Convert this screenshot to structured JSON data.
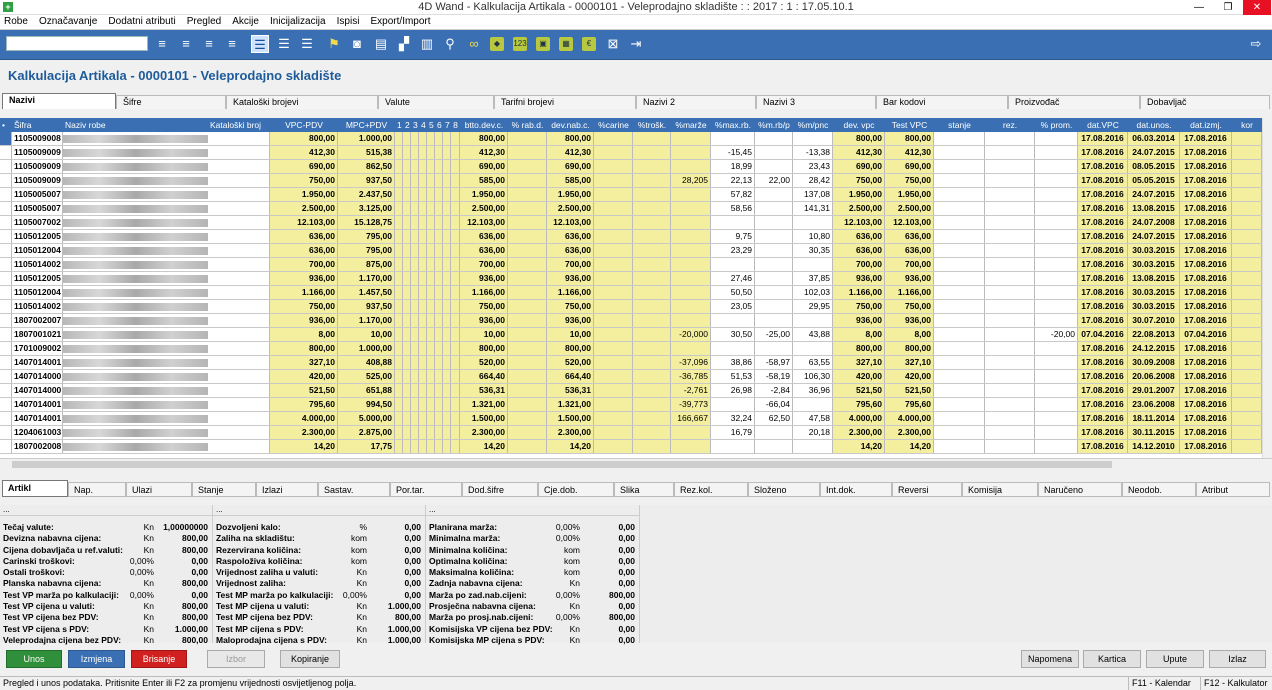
{
  "window": {
    "title": "4D Wand - Kalkulacija Artikala - 0000101 - Veleprodajno skladište : : 2017 : 1 : 17.05.10.1",
    "app_icon": "+",
    "minimize": "—",
    "maximize": "❐",
    "close": "✕"
  },
  "menu": [
    "Robe",
    "Označavanje",
    "Dodatni atributi",
    "Pregled",
    "Akcije",
    "Inicijalizacija",
    "Ispisi",
    "Export/Import"
  ],
  "toolbar": {
    "search_value": "",
    "icons": [
      "list-add-icon",
      "list-insert-icon",
      "list-remove-icon",
      "list-refresh-icon",
      "view-list-icon",
      "view-compact-icon",
      "view-lines-icon",
      "flag-icon",
      "camera-icon",
      "document-icon",
      "tree-icon",
      "trash-icon",
      "search-icon",
      "binoculars-icon",
      "tag-icon",
      "number-icon",
      "box-icon",
      "calendar-icon",
      "euro-icon",
      "cancel-icon",
      "indent-icon",
      "exit-icon"
    ]
  },
  "heading": "Kalkulacija Artikala - 0000101 - Veleprodajno skladište",
  "top_tabs": [
    "Nazivi",
    "Šifre",
    "Kataloški brojevi",
    "Valute",
    "Tarifni brojevi",
    "Nazivi 2",
    "Nazivi 3",
    "Bar kodovi",
    "Proizvođač",
    "Dobavljač"
  ],
  "grid": {
    "columns": [
      "•",
      "Šifra",
      "Naziv robe",
      "Kataloški broj",
      "VPC-PDV",
      "MPC+PDV",
      "1",
      "2",
      "3",
      "4",
      "5",
      "6",
      "7",
      "8",
      "btto.dev.c.",
      "% rab.d.",
      "dev.nab.c.",
      "%carine",
      "%trošk.",
      "%marže",
      "%max.rb.",
      "%m.rb/p",
      "%m/pnc",
      "dev. vpc",
      "Test VPC",
      "stanje",
      "rez.",
      "% prom.",
      "dat.VPC",
      "dat.unos.",
      "dat.izmj.",
      "kor"
    ],
    "rows": [
      [
        "1105009008",
        "800,00",
        "1.000,00",
        "800,00",
        "800,00",
        "",
        "",
        "",
        "",
        "",
        "800,00",
        "800,00",
        "17.08.2016",
        "06.03.2014",
        "17.08.2016"
      ],
      [
        "1105009009",
        "412,30",
        "515,38",
        "412,30",
        "412,30",
        "",
        "",
        "-15,45",
        "",
        "-13,38",
        "412,30",
        "412,30",
        "17.08.2016",
        "24.07.2015",
        "17.08.2016"
      ],
      [
        "1105009009",
        "690,00",
        "862,50",
        "690,00",
        "690,00",
        "",
        "",
        "18,99",
        "",
        "23,43",
        "690,00",
        "690,00",
        "17.08.2016",
        "08.05.2015",
        "17.08.2016"
      ],
      [
        "1105009009",
        "750,00",
        "937,50",
        "585,00",
        "585,00",
        "",
        "28,205",
        "22,13",
        "22,00",
        "28,42",
        "750,00",
        "750,00",
        "17.08.2016",
        "05.05.2015",
        "17.08.2016"
      ],
      [
        "1105005007",
        "1.950,00",
        "2.437,50",
        "1.950,00",
        "1.950,00",
        "",
        "",
        "57,82",
        "",
        "137,08",
        "1.950,00",
        "1.950,00",
        "17.08.2016",
        "24.07.2015",
        "17.08.2016"
      ],
      [
        "1105005007",
        "2.500,00",
        "3.125,00",
        "2.500,00",
        "2.500,00",
        "",
        "",
        "58,56",
        "",
        "141,31",
        "2.500,00",
        "2.500,00",
        "17.08.2016",
        "13.08.2015",
        "17.08.2016"
      ],
      [
        "1105007002",
        "12.103,00",
        "15.128,75",
        "12.103,00",
        "12.103,00",
        "",
        "",
        "",
        "",
        "",
        "12.103,00",
        "12.103,00",
        "17.08.2016",
        "24.07.2008",
        "17.08.2016"
      ],
      [
        "1105012005",
        "636,00",
        "795,00",
        "636,00",
        "636,00",
        "",
        "",
        "9,75",
        "",
        "10,80",
        "636,00",
        "636,00",
        "17.08.2016",
        "24.07.2015",
        "17.08.2016"
      ],
      [
        "1105012004",
        "636,00",
        "795,00",
        "636,00",
        "636,00",
        "",
        "",
        "23,29",
        "",
        "30,35",
        "636,00",
        "636,00",
        "17.08.2016",
        "30.03.2015",
        "17.08.2016"
      ],
      [
        "1105014002",
        "700,00",
        "875,00",
        "700,00",
        "700,00",
        "",
        "",
        "",
        "",
        "",
        "700,00",
        "700,00",
        "17.08.2016",
        "30.03.2015",
        "17.08.2016"
      ],
      [
        "1105012005",
        "936,00",
        "1.170,00",
        "936,00",
        "936,00",
        "",
        "",
        "27,46",
        "",
        "37,85",
        "936,00",
        "936,00",
        "17.08.2016",
        "13.08.2015",
        "17.08.2016"
      ],
      [
        "1105012004",
        "1.166,00",
        "1.457,50",
        "1.166,00",
        "1.166,00",
        "",
        "",
        "50,50",
        "",
        "102,03",
        "1.166,00",
        "1.166,00",
        "17.08.2016",
        "30.03.2015",
        "17.08.2016"
      ],
      [
        "1105014002",
        "750,00",
        "937,50",
        "750,00",
        "750,00",
        "",
        "",
        "23,05",
        "",
        "29,95",
        "750,00",
        "750,00",
        "17.08.2016",
        "30.03.2015",
        "17.08.2016"
      ],
      [
        "1807002007",
        "936,00",
        "1.170,00",
        "936,00",
        "936,00",
        "",
        "",
        "",
        "",
        "",
        "936,00",
        "936,00",
        "17.08.2016",
        "30.07.2010",
        "17.08.2016"
      ],
      [
        "1807001021",
        "8,00",
        "10,00",
        "10,00",
        "10,00",
        "",
        "-20,000",
        "30,50",
        "-25,00",
        "43,88",
        "8,00",
        "8,00",
        "07.04.2016",
        "22.08.2013",
        "07.04.2016"
      ],
      [
        "1701009002",
        "800,00",
        "1.000,00",
        "800,00",
        "800,00",
        "",
        "",
        "",
        "",
        "",
        "800,00",
        "800,00",
        "17.08.2016",
        "24.12.2015",
        "17.08.2016"
      ],
      [
        "1407014001",
        "327,10",
        "408,88",
        "520,00",
        "520,00",
        "",
        "-37,096",
        "38,86",
        "-58,97",
        "63,55",
        "327,10",
        "327,10",
        "17.08.2016",
        "30.09.2008",
        "17.08.2016"
      ],
      [
        "1407014000",
        "420,00",
        "525,00",
        "664,40",
        "664,40",
        "",
        "-36,785",
        "51,53",
        "-58,19",
        "106,30",
        "420,00",
        "420,00",
        "17.08.2016",
        "20.06.2008",
        "17.08.2016"
      ],
      [
        "1407014000",
        "521,50",
        "651,88",
        "536,31",
        "536,31",
        "",
        "-2,761",
        "26,98",
        "-2,84",
        "36,96",
        "521,50",
        "521,50",
        "17.08.2016",
        "29.01.2007",
        "17.08.2016"
      ],
      [
        "1407014001",
        "795,60",
        "994,50",
        "1.321,00",
        "1.321,00",
        "",
        "-39,773",
        "",
        "-66,04",
        "",
        "795,60",
        "795,60",
        "17.08.2016",
        "23.06.2008",
        "17.08.2016"
      ],
      [
        "1407014001",
        "4.000,00",
        "5.000,00",
        "1.500,00",
        "1.500,00",
        "",
        "166,667",
        "32,24",
        "62,50",
        "47,58",
        "4.000,00",
        "4.000,00",
        "17.08.2016",
        "18.11.2014",
        "17.08.2016"
      ],
      [
        "1204061003",
        "2.300,00",
        "2.875,00",
        "2.300,00",
        "2.300,00",
        "",
        "",
        "16,79",
        "",
        "20,18",
        "2.300,00",
        "2.300,00",
        "17.08.2016",
        "30.11.2015",
        "17.08.2016"
      ],
      [
        "1807002008",
        "14,20",
        "17,75",
        "14,20",
        "14,20",
        "",
        "",
        "",
        "",
        "",
        "14,20",
        "14,20",
        "17.08.2016",
        "14.12.2010",
        "17.08.2016"
      ]
    ],
    "prom_row14": "-20,00"
  },
  "bottom_tabs": [
    "Artikl",
    "Nap.",
    "Ulazi",
    "Stanje",
    "Izlazi",
    "Sastav.",
    "Por.tar.",
    "Dod.šifre",
    "Cje.dob.",
    "Slika",
    "Rez.kol.",
    "Složeno",
    "Int.dok.",
    "Reversi",
    "Komisija",
    "Naručeno",
    "Neodob.",
    "Atribut"
  ],
  "panel1": {
    "header": "...",
    "rows": [
      [
        "Tečaj valute:",
        "Kn",
        "1,00000000"
      ],
      [
        "Devizna nabavna cijena:",
        "Kn",
        "800,00"
      ],
      [
        "Cijena dobavljača u ref.valuti:",
        "Kn",
        "800,00"
      ],
      [
        "Carinski troškovi:",
        "0,00%",
        "0,00"
      ],
      [
        "Ostali troškovi:",
        "0,00%",
        "0,00"
      ],
      [
        "Planska nabavna cijena:",
        "Kn",
        "800,00"
      ],
      [
        "Test VP marža po kalkulaciji:",
        "0,00%",
        "0,00"
      ],
      [
        "Test VP cijena u valuti:",
        "Kn",
        "800,00"
      ],
      [
        "Test VP cijena bez PDV:",
        "Kn",
        "800,00"
      ],
      [
        "Test VP cijena s PDV:",
        "Kn",
        "1.000,00"
      ],
      [
        "Veleprodajna cijena bez PDV:",
        "Kn",
        "800,00"
      ]
    ]
  },
  "panel2": {
    "header": "...",
    "rows": [
      [
        "Dozvoljeni kalo:",
        "%",
        "0,00"
      ],
      [
        "Zaliha na skladištu:",
        "kom",
        "0,00"
      ],
      [
        "Rezervirana količina:",
        "kom",
        "0,00"
      ],
      [
        "Raspoloživa količina:",
        "kom",
        "0,00"
      ],
      [
        "Vrijednost zaliha u valuti:",
        "Kn",
        "0,00"
      ],
      [
        "Vrijednost zaliha:",
        "Kn",
        "0,00"
      ],
      [
        "Test MP marža po kalkulaciji:",
        "0,00%",
        "0,00"
      ],
      [
        "Test MP cijena u valuti:",
        "Kn",
        "1.000,00"
      ],
      [
        "Test MP cijena bez PDV:",
        "Kn",
        "800,00"
      ],
      [
        "Test MP cijena s PDV:",
        "Kn",
        "1.000,00"
      ],
      [
        "Maloprodajna cijena s PDV:",
        "Kn",
        "1.000,00"
      ]
    ]
  },
  "panel3": {
    "header": "...",
    "rows": [
      [
        "Planirana marža:",
        "0,00%",
        "0,00"
      ],
      [
        "Minimalna marža:",
        "0,00%",
        "0,00"
      ],
      [
        "Minimalna količina:",
        "kom",
        "0,00"
      ],
      [
        "Optimalna količina:",
        "kom",
        "0,00"
      ],
      [
        "Maksimalna količina:",
        "kom",
        "0,00"
      ],
      [
        "Zadnja nabavna cijena:",
        "Kn",
        "0,00"
      ],
      [
        "Marža po zad.nab.cijeni:",
        "0,00%",
        "800,00"
      ],
      [
        "Prosječna nabavna cijena:",
        "Kn",
        "0,00"
      ],
      [
        "Marža po prosj.nab.cijeni:",
        "0,00%",
        "800,00"
      ],
      [
        "Komisijska VP cijena bez PDV:",
        "Kn",
        "0,00"
      ],
      [
        "Komisijska MP cijena s PDV:",
        "Kn",
        "0,00"
      ]
    ]
  },
  "buttons": {
    "unos": "Unos",
    "izmjena": "Izmjena",
    "brisanje": "Brisanje",
    "izbor": "Izbor",
    "kopiranje": "Kopiranje",
    "napomena": "Napomena",
    "kartica": "Kartica",
    "upute": "Upute",
    "izlaz": "Izlaz"
  },
  "status": {
    "message": "Pregled i unos podataka. Pritisnite Enter ili F2 za promjenu vrijednosti osvijetljenog polja.",
    "f11": "F11 - Kalendar",
    "f12": "F12 - Kalkulator"
  },
  "colors": {
    "accent": "#3a70b3",
    "heading": "#1e5b9a",
    "yellow_cell": "#f3ef9e",
    "green": "#2f8f3a",
    "red": "#d02020"
  }
}
